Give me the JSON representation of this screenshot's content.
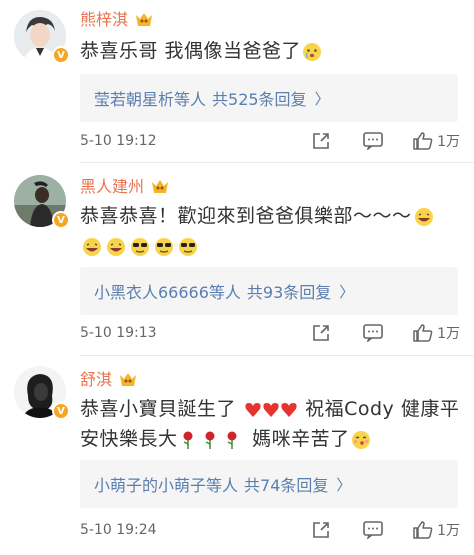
{
  "comments": [
    {
      "username": "熊梓淇",
      "text_parts": [
        "恭喜乐哥 我偶像当爸爸了"
      ],
      "reply": {
        "names": "莹若朝星析等人",
        "count_text": "共525条回复"
      },
      "time": "5-10 19:12",
      "likes": "1万",
      "avatar_icon": "avatar-photo-icon",
      "inline_icons": [
        "teary-emoji-icon"
      ]
    },
    {
      "username": "黑人建州",
      "text_parts": [
        "恭喜恭喜！歡迎來到爸爸俱樂部～～～"
      ],
      "reply": {
        "names": "小黑衣人66666等人",
        "count_text": "共93条回复"
      },
      "time": "5-10 19:13",
      "likes": "1万",
      "avatar_icon": "avatar-photo-icon",
      "inline_icons": [
        "laughing-emoji-icon",
        "laughing-emoji-icon",
        "laughing-emoji-icon",
        "sunglasses-emoji-icon",
        "sunglasses-emoji-icon",
        "sunglasses-emoji-icon"
      ]
    },
    {
      "username": "舒淇",
      "text_parts": [
        "恭喜小寶貝誕生了",
        "祝福Cody 健康平安快樂長大",
        "媽咪辛苦了"
      ],
      "reply": {
        "names": "小萌子的小萌子等人",
        "count_text": "共74条回复"
      },
      "time": "5-10 19:24",
      "likes": "1万",
      "avatar_icon": "avatar-photo-icon",
      "inline_icons": [
        "heart-emoji-icon",
        "rose-emoji-icon",
        "kiss-emoji-icon"
      ]
    }
  ],
  "reply_chevron": "〉",
  "colors": {
    "username": "#eb7350",
    "reply_link": "#5b7eaf",
    "reply_bg": "#f5f5f5",
    "badge": "#f5a623"
  }
}
